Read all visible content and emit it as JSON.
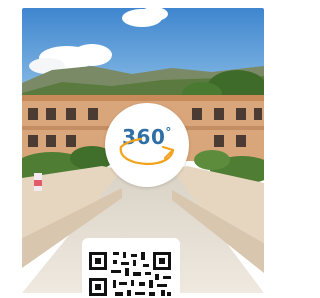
{
  "panorama": {
    "label": "360",
    "degree_symbol": "°",
    "accent_color": "#2e6fa8",
    "arrow_color": "#f2a21c",
    "icon": "360-rotate-icon"
  },
  "qr": {
    "icon": "qr-code-icon"
  }
}
